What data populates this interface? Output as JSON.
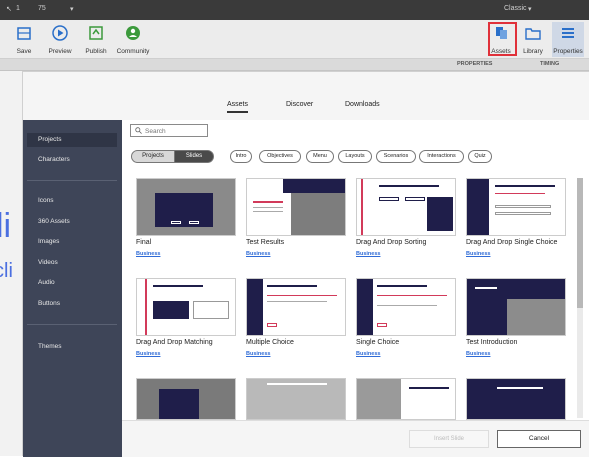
{
  "topbar": {
    "item1": "1",
    "zoom": "75",
    "workspace": "Classic"
  },
  "toolbar": {
    "save": "Save",
    "preview": "Preview",
    "publish": "Publish",
    "community": "Community",
    "assets": "Assets",
    "library": "Library",
    "properties": "Properties"
  },
  "panel_tabs": {
    "properties": "PROPERTIES",
    "timing": "TIMING"
  },
  "stage_text": {
    "line1": "li",
    "line2": "cli"
  },
  "modal": {
    "tabs": [
      "Assets",
      "Discover",
      "Downloads"
    ],
    "sidebar": {
      "group1": [
        "Projects",
        "Characters"
      ],
      "group2": [
        "Icons",
        "360 Assets",
        "Images",
        "Videos",
        "Audio",
        "Buttons"
      ],
      "group3": [
        "Themes"
      ]
    },
    "search_placeholder": "Search",
    "segments": [
      "Projects",
      "Slides"
    ],
    "chips": [
      "Intro",
      "Objectives",
      "Menu",
      "Layouts",
      "Scenarios",
      "Interactions",
      "Quiz"
    ],
    "cards": [
      {
        "title": "Final",
        "tag": "Business"
      },
      {
        "title": "Test Results",
        "tag": "Business"
      },
      {
        "title": "Drag And Drop Sorting",
        "tag": "Business"
      },
      {
        "title": "Drag And Drop Single Choice",
        "tag": "Business"
      },
      {
        "title": "Drag And Drop Matching",
        "tag": "Business"
      },
      {
        "title": "Multiple Choice",
        "tag": "Business"
      },
      {
        "title": "Single Choice",
        "tag": "Business"
      },
      {
        "title": "Test Introduction",
        "tag": "Business"
      }
    ],
    "footer": {
      "insert": "Insert Slide",
      "cancel": "Cancel"
    }
  },
  "colors": {
    "sidebar": "#3e4558",
    "accent": "#2f6bd6",
    "highlight": "#e0313a",
    "navy": "#1f1e4a"
  }
}
